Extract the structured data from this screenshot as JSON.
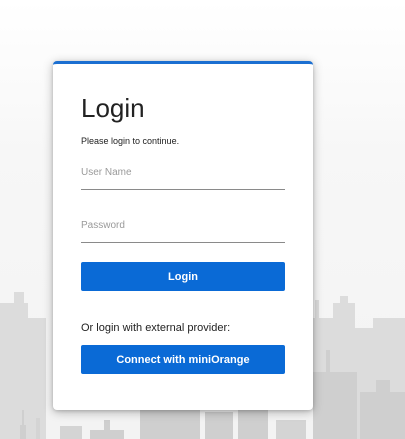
{
  "login": {
    "title": "Login",
    "subtitle": "Please login to continue.",
    "username_placeholder": "User Name",
    "username_value": "",
    "password_placeholder": "Password",
    "password_value": "",
    "login_button": "Login",
    "external_text": "Or login with external provider:",
    "provider_button": "Connect with miniOrange"
  },
  "colors": {
    "accent": "#0a6ad6",
    "card_top_border": "#1b6fd1",
    "background": "#f4f4f4",
    "skyline": "#d6d6d6"
  }
}
